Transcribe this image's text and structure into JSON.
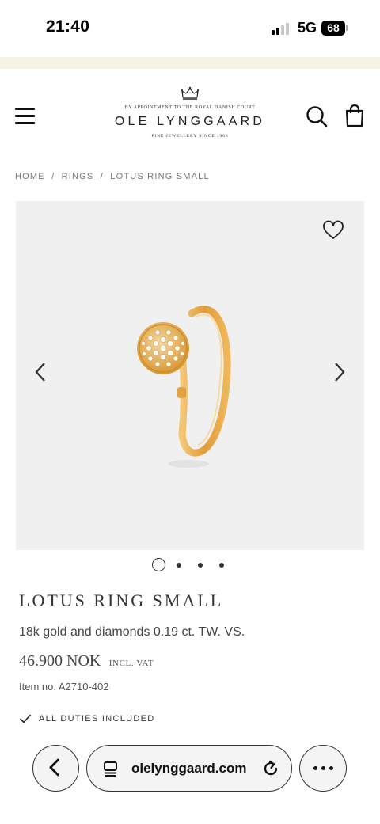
{
  "status_bar": {
    "time": "21:40",
    "network": "5G",
    "battery": "68"
  },
  "header": {
    "logo": {
      "top_line": "BY APPOINTMENT TO THE ROYAL DANISH COURT",
      "brand": "OLE LYNGGAARD",
      "sub_line": "FINE JEWELLERY SINCE 1963"
    }
  },
  "breadcrumb": [
    "HOME",
    "/",
    "RINGS",
    "/",
    "LOTUS RING SMALL"
  ],
  "gallery": {
    "current_slide": 1,
    "total_slides": 4
  },
  "product": {
    "title": "LOTUS RING SMALL",
    "description": "18k gold and diamonds 0.19 ct. TW. VS.",
    "price": "46.900 NOK",
    "vat_label": "INCL. VAT",
    "item_no": "Item no. A2710-402",
    "duties_label": "ALL DUTIES INCLUDED"
  },
  "browser": {
    "url": "olelynggaard.com"
  },
  "icons": {
    "menu": "menu-icon",
    "search": "search-icon",
    "bag": "bag-icon",
    "wishlist": "heart-icon",
    "prev": "chevron-left-icon",
    "next": "chevron-right-icon",
    "check": "check-icon",
    "back": "chevron-left-icon",
    "tabs": "tabs-icon",
    "reload": "reload-icon",
    "more": "ellipsis-icon"
  },
  "colors": {
    "promo_strip": "#f7f3e3",
    "gallery_bg": "#f0f0f0",
    "gold": "#e0a84a"
  }
}
